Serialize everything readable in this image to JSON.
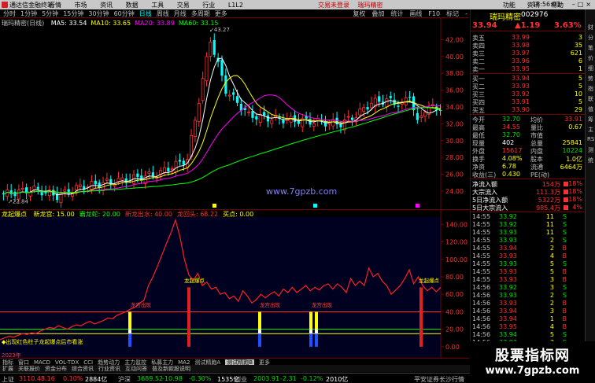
{
  "titlebar": {
    "app_name": "通达信金融终端",
    "menu": [
      "行情",
      "市场",
      "资讯",
      "数据",
      "工具",
      "交易",
      "行业",
      "L1L2"
    ],
    "notice": [
      "交易未登录",
      "瑞玛精密"
    ],
    "right_items": [
      "功能",
      "资讯",
      "帮助"
    ],
    "clock": "18:56:03"
  },
  "toolbar": {
    "periods": [
      "分时",
      "1分钟",
      "5分钟",
      "15分钟",
      "30分钟",
      "60分钟",
      "日线",
      "周线",
      "月线",
      "多周期",
      "更多"
    ],
    "active_period": "日线",
    "right": [
      "复权",
      "叠加",
      "统计",
      "画线",
      "F10",
      "标记",
      "-"
    ]
  },
  "main_chart": {
    "name": "瑞玛精密(日线)",
    "ma_legend": [
      {
        "label": "MA5: 33.54",
        "color": "#ffffff"
      },
      {
        "label": "MA10: 33.65",
        "color": "#ffff00"
      },
      {
        "label": "MA20: 33.89",
        "color": "#ff00ff"
      },
      {
        "label": "MA60: 33.15",
        "color": "#00ff00"
      }
    ],
    "high_label": "43.27",
    "low_label": "22.84",
    "axis_labels": [
      "42.00",
      "40.00",
      "38.00",
      "36.00",
      "34.00",
      "32.00",
      "30.00",
      "28.00",
      "26.00",
      "24.00"
    ],
    "axis_values": [
      42,
      40,
      38,
      36,
      34,
      32,
      30,
      28,
      26,
      24
    ],
    "ymin": 22.5,
    "ymax": 44,
    "watermark": "www.7gpzb.com"
  },
  "indicator": {
    "name": "龙起爆点",
    "legend": [
      {
        "label": "新龙宫: 15.00",
        "color": "#ffff00"
      },
      {
        "label": "霸龙蛇: 20.00",
        "color": "#00ff00"
      },
      {
        "label": "新龙出水: 40.00",
        "color": "#ff3030"
      },
      {
        "label": "龙回头: 68.22",
        "color": "#ff3030"
      },
      {
        "label": "买点: 0.00",
        "color": "#ffff00"
      }
    ],
    "axis_labels": [
      "140.00",
      "120.00",
      "100.00",
      "80.00",
      "60.00",
      "40.00",
      "20.00",
      "0.00"
    ],
    "axis_values": [
      140,
      120,
      100,
      80,
      60,
      40,
      20,
      0
    ],
    "ymin": -10,
    "ymax": 152,
    "signal_labels": [
      "龙宫出现",
      "龙起爆点",
      "龙宫出现",
      "龙宫出现",
      "龙起爆点",
      "龙起爆点"
    ],
    "footnote": "◆出现红色柱子龙起爆点后市看涨",
    "year": "2023年"
  },
  "chart_data": {
    "type": "line",
    "series": [
      {
        "name": "龙回头",
        "values": [
          8,
          10,
          12,
          11,
          13,
          15,
          14,
          16,
          15,
          18,
          20,
          22,
          21,
          24,
          22,
          20,
          23,
          25,
          24,
          27,
          29,
          26,
          28,
          30,
          33,
          32,
          36,
          38,
          40,
          43,
          45,
          50,
          53,
          70,
          80,
          92,
          105,
          118,
          130,
          145,
          126,
          100,
          82,
          76,
          84,
          70,
          74,
          66,
          68,
          60,
          62,
          55,
          58,
          52,
          64,
          58,
          50,
          54,
          60,
          56,
          60,
          63,
          58,
          66,
          62,
          68,
          62,
          66,
          70,
          64,
          68,
          65,
          70,
          72,
          66,
          72,
          68,
          62,
          78,
          70,
          75,
          70,
          90,
          80,
          84,
          75,
          70,
          60,
          65,
          70,
          78,
          88,
          72,
          80,
          70,
          64,
          68,
          63,
          68
        ]
      }
    ]
  },
  "tabs1": [
    "指标",
    "窗口",
    "MACD",
    "VOL-TDX",
    "CCI",
    "趋势动力",
    "主力监控",
    "私募主力",
    "MA2",
    "测试精跑A",
    "测试精跑B",
    "更多"
  ],
  "tabs1_selected": "测试精跑B",
  "tabs2": [
    "扩展",
    "关联报价",
    "资金分布",
    "综合资讯",
    "行业资讯",
    "互动问答",
    "普及新款股说明"
  ],
  "tabs2_right": "图形F10 数据统计",
  "status": {
    "items": [
      {
        "name": "上证",
        "value": "3110.48",
        "chg": "3.16",
        "pct": "0.10%",
        "amt": "2884亿",
        "cls": "red"
      },
      {
        "name": "沪深",
        "value": "3689.52",
        "chg": "-10.98",
        "pct": "-0.30%",
        "amt": "1535亿",
        "cls": "green"
      },
      {
        "name": "创业",
        "value": "2003.91",
        "chg": "-2.31",
        "pct": "-0.12%",
        "amt": "2010亿",
        "cls": "green"
      }
    ],
    "right": "平安证券长沙行情"
  },
  "quote": {
    "name": "瑞玛精密",
    "code": "002976",
    "price": "33.94",
    "change": "▲1.19",
    "pct": "3.63%",
    "sells": [
      {
        "label": "卖五",
        "price": "33.99",
        "vol": "3"
      },
      {
        "label": "卖四",
        "price": "33.98",
        "vol": "35"
      },
      {
        "label": "卖三",
        "price": "33.97",
        "vol": "621"
      },
      {
        "label": "卖二",
        "price": "33.96",
        "vol": "6"
      },
      {
        "label": "卖一",
        "price": "33.95",
        "vol": "1"
      }
    ],
    "buys": [
      {
        "label": "买一",
        "price": "33.94",
        "vol": "5"
      },
      {
        "label": "买二",
        "price": "33.93",
        "vol": "5"
      },
      {
        "label": "买三",
        "price": "33.92",
        "vol": "10"
      },
      {
        "label": "买四",
        "price": "33.91",
        "vol": "5"
      },
      {
        "label": "买五",
        "price": "33.90",
        "vol": "29"
      }
    ],
    "stats": [
      {
        "l1": "今开",
        "v1": "32.70",
        "c1": "green",
        "l2": "均价",
        "v2": "33.91",
        "c2": "red"
      },
      {
        "l1": "最高",
        "v1": "34.55",
        "c1": "red",
        "l2": "量比",
        "v2": "0.67",
        "c2": "yellow"
      },
      {
        "l1": "最低",
        "v1": "32.70",
        "c1": "green",
        "l2": "市值",
        "v2": "",
        "c2": "yellow"
      },
      {
        "l1": "现量",
        "v1": "402",
        "c1": "white",
        "l2": "总量",
        "v2": "25841",
        "c2": "yellow"
      },
      {
        "l1": "外盘",
        "v1": "15617",
        "c1": "red",
        "l2": "内盘",
        "v2": "10224",
        "c2": "green"
      },
      {
        "l1": "换手",
        "v1": "4.08%",
        "c1": "yellow",
        "l2": "股本",
        "v2": "1.0亿",
        "c2": "yellow"
      },
      {
        "l1": "净资",
        "v1": "6.78",
        "c1": "yellow",
        "l2": "流通",
        "v2": "6464万",
        "c2": "yellow"
      },
      {
        "l1": "收益(三)",
        "v1": "0.430",
        "c1": "yellow",
        "l2": "PE(动)",
        "v2": "",
        "c2": "yellow"
      }
    ],
    "flows": [
      {
        "label": "净流入额",
        "value": "154万",
        "pct": "18%"
      },
      {
        "label": "大宗流入",
        "value": "111.3万",
        "pct": "18%"
      },
      {
        "label": "5日净流入额",
        "value": "5322万",
        "pct": "18%"
      },
      {
        "label": "5日大宗流入",
        "value": "985.4万",
        "pct": "4%"
      }
    ],
    "ticks": [
      {
        "time": "14:55",
        "price": "33.92",
        "vol": "11",
        "dir": "S"
      },
      {
        "time": "14:55",
        "price": "33.92",
        "vol": "11",
        "dir": "S"
      },
      {
        "time": "14:55",
        "price": "33.93",
        "vol": "11",
        "dir": "S"
      },
      {
        "time": "14:55",
        "price": "33.93",
        "vol": "2",
        "dir": "S"
      },
      {
        "time": "14:55",
        "price": "33.94",
        "vol": "2",
        "dir": "B"
      },
      {
        "time": "14:55",
        "price": "33.93",
        "vol": "4",
        "dir": "B"
      },
      {
        "time": "14:55",
        "price": "33.93",
        "vol": "5",
        "dir": "S"
      },
      {
        "time": "14:55",
        "price": "33.93",
        "vol": "5",
        "dir": "B"
      },
      {
        "time": "14:55",
        "price": "33.93",
        "vol": "3",
        "dir": "B"
      },
      {
        "time": "14:56",
        "price": "33.92",
        "vol": "3",
        "dir": "S"
      },
      {
        "time": "14:56",
        "price": "33.93",
        "vol": "2",
        "dir": "S"
      },
      {
        "time": "14:56",
        "price": "33.93",
        "vol": "2",
        "dir": "B"
      },
      {
        "time": "14:56",
        "price": "33.94",
        "vol": "3",
        "dir": "B"
      },
      {
        "time": "14:56",
        "price": "33.94",
        "vol": "1",
        "dir": "B"
      },
      {
        "time": "14:56",
        "price": "33.95",
        "vol": "4",
        "dir": "B"
      },
      {
        "time": "14:56",
        "price": "33.94",
        "vol": "5",
        "dir": "S"
      },
      {
        "time": "14:56",
        "price": "33.93",
        "vol": "3",
        "dir": "S"
      },
      {
        "time": "14:56",
        "price": "33.93",
        "vol": "3",
        "dir": "B"
      },
      {
        "time": "14:56",
        "price": "33.94",
        "vol": "1",
        "dir": "B"
      },
      {
        "time": "15:00",
        "price": "33.94",
        "vol": "3",
        "dir": "S"
      }
    ]
  },
  "watermark_bottom": {
    "title": "股票指标网",
    "url": "www.7gpzb.com"
  },
  "side_strip": [
    "财",
    "分",
    "笔",
    "价",
    "细",
    "势",
    "指",
    "联",
    "值",
    "筹",
    "主",
    "RS",
    "测",
    "统"
  ],
  "colors": {
    "up": "#ff3030",
    "down": "#00ffff",
    "background": "#000000",
    "border": "#700000",
    "indicator_bg": "#000020"
  }
}
